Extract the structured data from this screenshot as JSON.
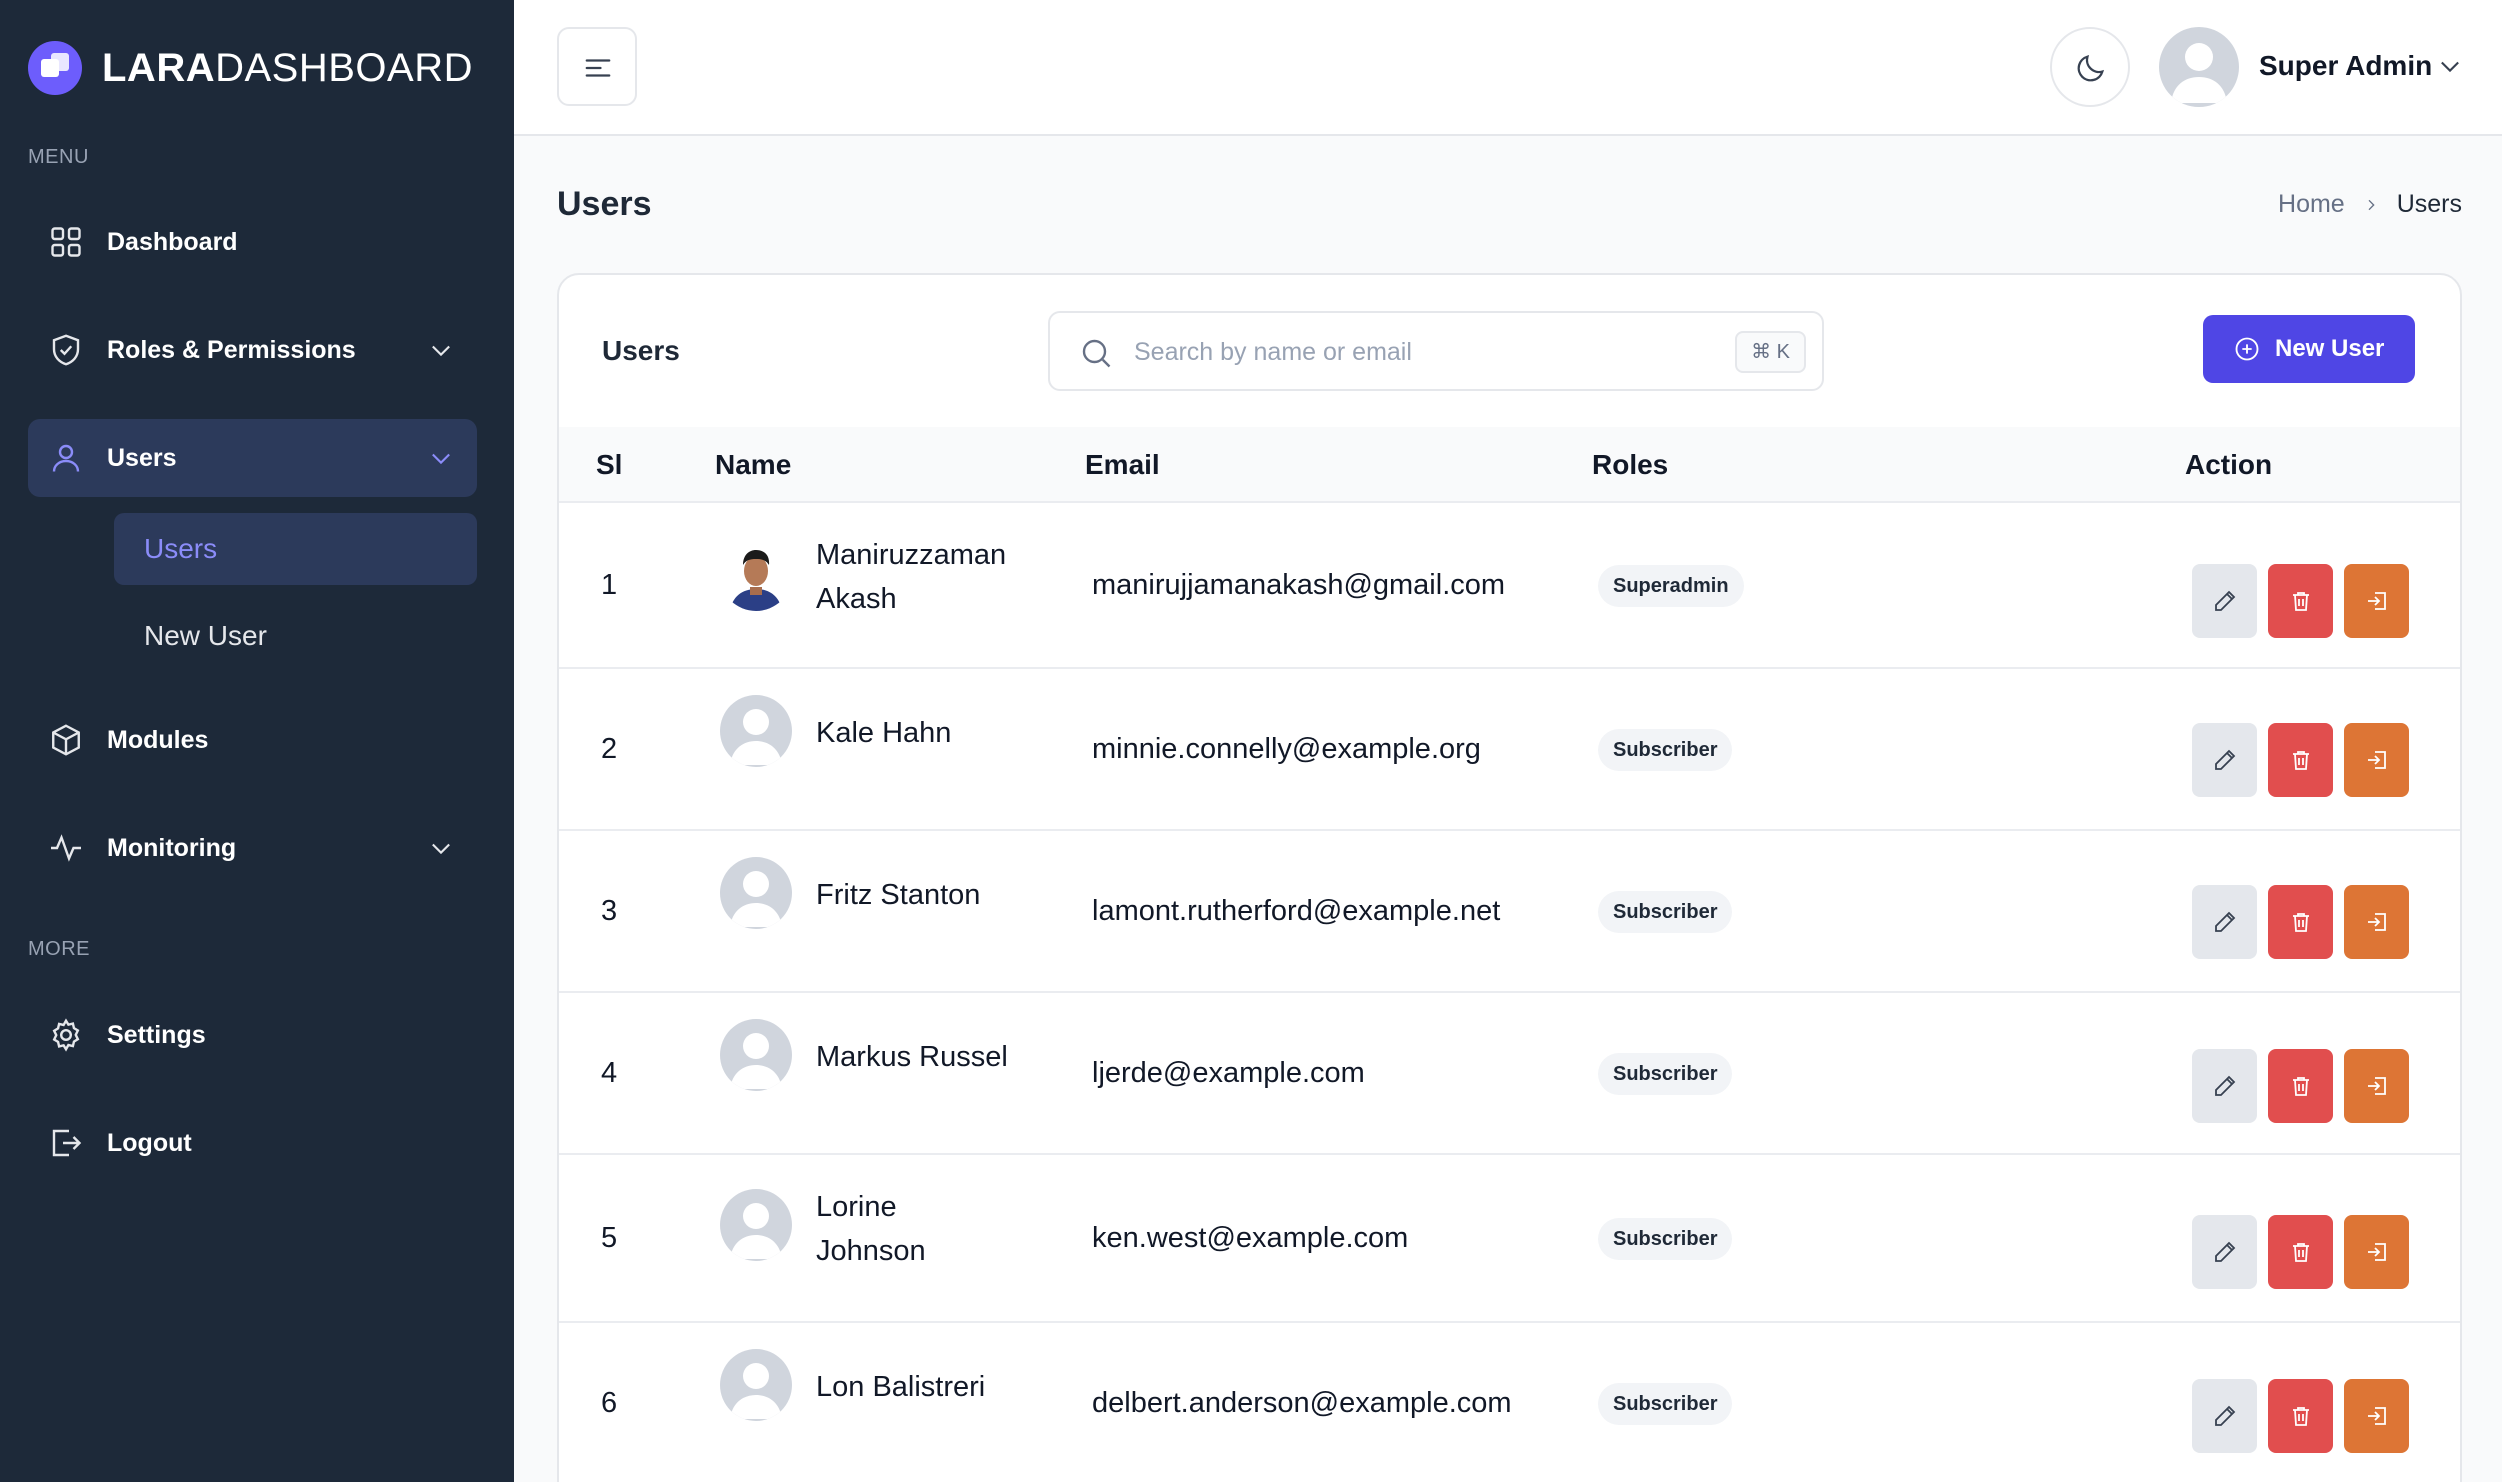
{
  "brand": {
    "name_bold": "LARA",
    "name_light": "DASHBOARD",
    "accent": "#6d5dfc"
  },
  "sidebar": {
    "menu_label": "MENU",
    "more_label": "MORE",
    "items": [
      {
        "label": "Dashboard",
        "icon": "dashboard-grid-icon"
      },
      {
        "label": "Roles & Permissions",
        "icon": "shield-check-icon"
      },
      {
        "label": "Users",
        "icon": "user-icon"
      },
      {
        "label": "Modules",
        "icon": "cube-icon"
      },
      {
        "label": "Monitoring",
        "icon": "activity-icon"
      }
    ],
    "users_submenu": [
      {
        "label": "Users"
      },
      {
        "label": "New User"
      }
    ],
    "more_items": [
      {
        "label": "Settings",
        "icon": "gear-icon"
      },
      {
        "label": "Logout",
        "icon": "logout-icon"
      }
    ]
  },
  "header": {
    "user_name": "Super Admin"
  },
  "page": {
    "title": "Users"
  },
  "breadcrumb": {
    "home": "Home",
    "current": "Users"
  },
  "card": {
    "title": "Users",
    "search_placeholder": "Search by name or email",
    "shortcut": "⌘ K",
    "new_user_label": "New User",
    "new_user_color": "#4f46e5"
  },
  "table": {
    "columns": {
      "si": "Sl",
      "name": "Name",
      "email": "Email",
      "roles": "Roles",
      "action": "Action"
    },
    "rows": [
      {
        "si": "1",
        "name": "Maniruzzaman Akash",
        "email": "manirujjamanakash@gmail.com",
        "role": "Superadmin"
      },
      {
        "si": "2",
        "name": "Kale Hahn",
        "email": "minnie.connelly@example.org",
        "role": "Subscriber"
      },
      {
        "si": "3",
        "name": "Fritz Stanton",
        "email": "lamont.rutherford@example.net",
        "role": "Subscriber"
      },
      {
        "si": "4",
        "name": "Markus Russel",
        "email": "ljerde@example.com",
        "role": "Subscriber"
      },
      {
        "si": "5",
        "name": "Lorine Johnson",
        "email": "ken.west@example.com",
        "role": "Subscriber"
      },
      {
        "si": "6",
        "name": "Lon Balistreri",
        "email": "delbert.anderson@example.com",
        "role": "Subscriber"
      }
    ],
    "action_colors": {
      "edit": "#e4e7ec",
      "delete": "#e14e4e",
      "login_as": "#dd7535"
    }
  }
}
